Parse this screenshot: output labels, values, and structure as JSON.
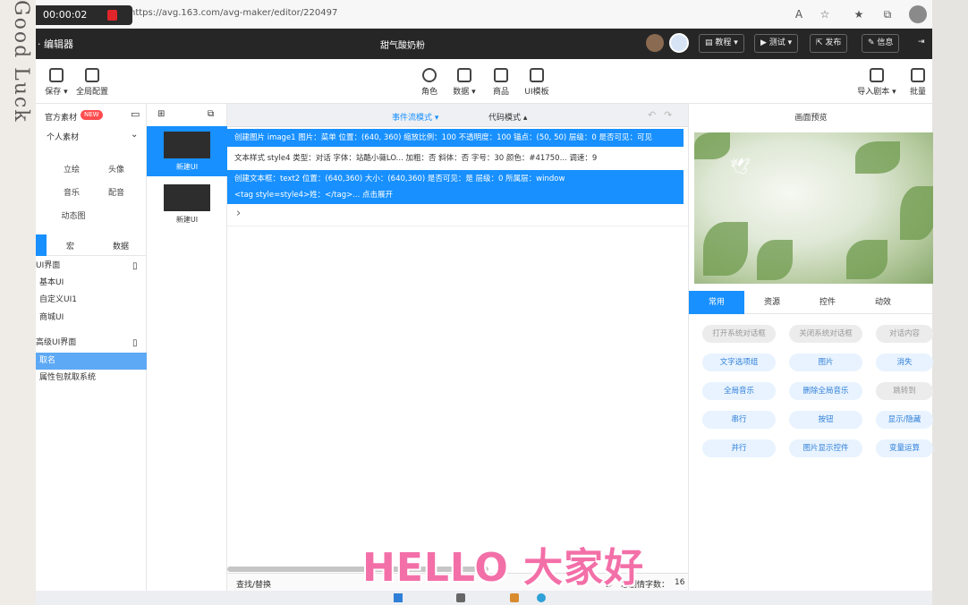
{
  "overlay": {
    "handwriting": "Good Luck",
    "caption": "HELLO 大家好",
    "recording_time": "00:00:02"
  },
  "browser": {
    "url": "https://avg.163.com/avg-maker/editor/220497"
  },
  "app": {
    "name": "· 编辑器",
    "project_name": "甜气酸奶粉",
    "top_buttons": [
      "教程",
      "测试",
      "发布",
      "信息"
    ]
  },
  "toolbar": {
    "left": [
      "保存",
      "全局配置"
    ],
    "center": [
      "角色",
      "数据",
      "商品",
      "UI模板"
    ],
    "right": [
      "导入剧本",
      "批量"
    ]
  },
  "left_panel": {
    "title": "官方素材",
    "badge": "NEW",
    "personal_select": "个人素材",
    "categories": [
      "立绘",
      "头像",
      "音乐",
      "配音",
      "动态图"
    ],
    "tabs": [
      "宏",
      "数据"
    ],
    "tree": [
      {
        "label": "UI界面",
        "selected": false
      },
      {
        "label": "基本UI",
        "selected": false
      },
      {
        "label": "自定义UI1",
        "selected": false
      },
      {
        "label": "商城UI",
        "selected": false
      },
      {
        "label": "高级UI界面",
        "selected": false
      },
      {
        "label": "取名",
        "selected": true
      },
      {
        "label": "属性包就取系统",
        "selected": false
      }
    ]
  },
  "ui_list": [
    "新建UI",
    "新建UI"
  ],
  "flow": {
    "tabs": [
      "事件流模式",
      "代码模式"
    ],
    "rows": [
      "创建图片  image1  图片：菜单  位置：(640, 360)  缩放比例：100  不透明度：100  锚点：(50, 50)  层级：0  是否可见：可见",
      "文本样式  style4  类型：对话  字体：站酷小薇LO...  加粗：否  斜体：否  字号：30  颜色：#41750...  调速：9",
      "创建文本框：text2  位置：(640,360)  大小：(640,360)  是否可见：是  层级：0  所属层：window",
      "<tag style=style4>姓：</tag>...  点击展开"
    ],
    "find_replace": "查找/替换",
    "word_count_label": "总剧情字数：",
    "word_count": "16"
  },
  "right_panel": {
    "preview_title": "画面预览",
    "tabs": [
      "常用",
      "资源",
      "控件",
      "动效"
    ],
    "commands": [
      {
        "label": "打开系统对话框",
        "disabled": true
      },
      {
        "label": "关闭系统对话框",
        "disabled": true
      },
      {
        "label": "对话内容",
        "disabled": true
      },
      {
        "label": "文字选项组",
        "disabled": false
      },
      {
        "label": "图片",
        "disabled": false
      },
      {
        "label": "消失",
        "disabled": false
      },
      {
        "label": "全局音乐",
        "disabled": false
      },
      {
        "label": "删除全局音乐",
        "disabled": false
      },
      {
        "label": "跳转到",
        "disabled": true
      },
      {
        "label": "串行",
        "disabled": false
      },
      {
        "label": "按钮",
        "disabled": false
      },
      {
        "label": "显示/隐藏",
        "disabled": false
      },
      {
        "label": "并行",
        "disabled": false
      },
      {
        "label": "图片显示控件",
        "disabled": false
      },
      {
        "label": "变量运算",
        "disabled": false
      }
    ]
  },
  "colors": {
    "accent": "#1890ff",
    "appbar": "#262626",
    "caption": "#f36fa8"
  }
}
